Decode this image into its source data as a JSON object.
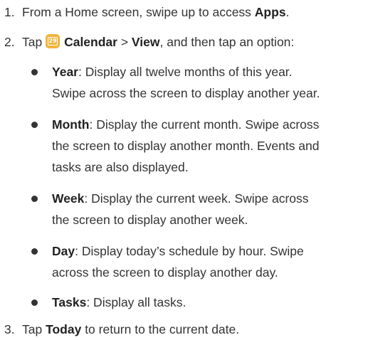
{
  "steps": [
    {
      "num": "1.",
      "pre": "From a Home screen, swipe up to access ",
      "bold": "Apps",
      "post": "."
    },
    {
      "num": "2.",
      "pre": "Tap ",
      "icon": "calendar-app-icon",
      "icon_text": "29",
      "bold1": "Calendar",
      "sep": " > ",
      "bold2": "View",
      "post": ", and then tap an option:"
    },
    {
      "num": "3.",
      "pre": "Tap ",
      "bold": "Today",
      "post": " to return to the current date."
    }
  ],
  "options": [
    {
      "term": "Year",
      "lines": [
        ": Display all twelve months of this year.",
        "Swipe across the screen to display another year."
      ]
    },
    {
      "term": "Month",
      "lines": [
        ": Display the current month. Swipe across",
        "the screen to display another month. Events and",
        "tasks are also displayed."
      ]
    },
    {
      "term": "Week",
      "lines": [
        ": Display the current week. Swipe across",
        "the screen to display another week."
      ]
    },
    {
      "term": "Day",
      "lines": [
        ": Display today’s schedule by hour. Swipe",
        "across the screen to display another day."
      ]
    },
    {
      "term": "Tasks",
      "lines": [
        ": Display all tasks."
      ]
    }
  ],
  "colors": {
    "text": "#333333",
    "icon_bg": "#f2b43a"
  }
}
